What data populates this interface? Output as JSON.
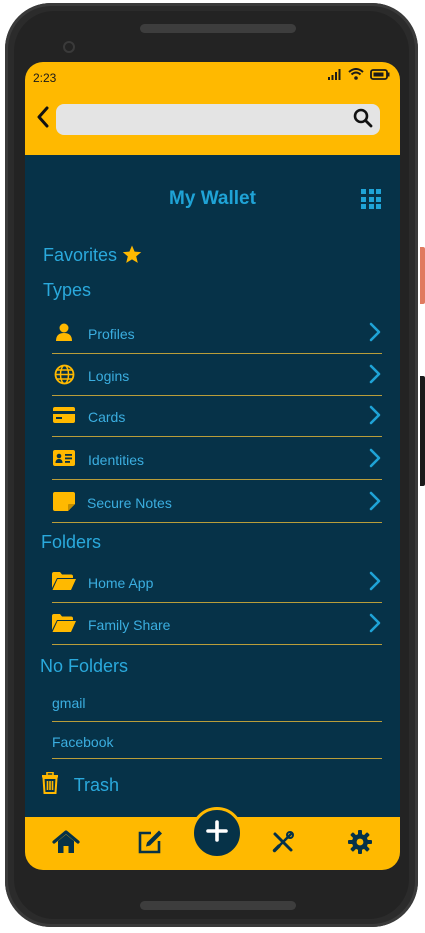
{
  "status": {
    "time": "2:23"
  },
  "search": {
    "placeholder": ""
  },
  "page": {
    "title": "My Wallet"
  },
  "sections": {
    "favorites": "Favorites",
    "types": "Types",
    "folders": "Folders",
    "no_folders": "No Folders",
    "trash": "Trash"
  },
  "types": [
    {
      "label": "Profiles",
      "icon": "person-icon"
    },
    {
      "label": "Logins",
      "icon": "globe-icon"
    },
    {
      "label": "Cards",
      "icon": "credit-card-icon"
    },
    {
      "label": "Identities",
      "icon": "id-card-icon"
    },
    {
      "label": "Secure Notes",
      "icon": "note-icon"
    }
  ],
  "folders": [
    {
      "label": "Home App",
      "icon": "folder-open-icon"
    },
    {
      "label": "Family Share",
      "icon": "folder-open-icon"
    }
  ],
  "no_folder_items": [
    "gmail",
    "Facebook"
  ],
  "colors": {
    "accent": "#ffb900",
    "background": "#063248",
    "text": "#3baee0",
    "title": "#1fa3d6",
    "divider": "#b99d3a"
  },
  "bottom_nav": [
    "home-icon",
    "edit-icon",
    "add-icon",
    "tools-icon",
    "settings-icon"
  ]
}
